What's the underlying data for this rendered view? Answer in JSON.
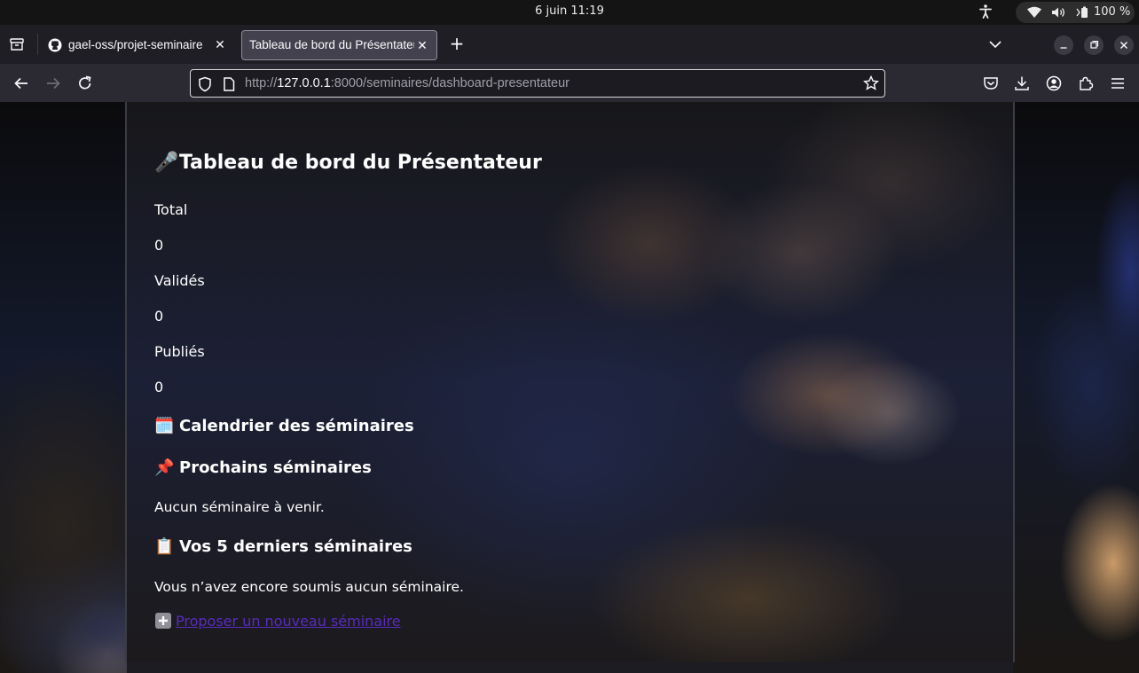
{
  "os": {
    "clock": "6 juin  11:19",
    "battery": "100 %"
  },
  "browser": {
    "tabs": [
      {
        "title": "gael-oss/projet-seminaire",
        "favicon": "github-icon",
        "active": false
      },
      {
        "title": "Tableau de bord du Présentateur",
        "favicon": "",
        "active": true
      }
    ],
    "url": {
      "scheme": "http://",
      "host": "127.0.0.1",
      "rest": ":8000/seminaires/dashboard-presentateur"
    }
  },
  "page": {
    "title_emoji": "🎤",
    "title": "Tableau de bord du Présentateur",
    "stats": [
      {
        "label": "Total",
        "value": "0"
      },
      {
        "label": "Validés",
        "value": "0"
      },
      {
        "label": "Publiés",
        "value": "0"
      }
    ],
    "calendar": {
      "emoji": "🗓️",
      "heading": "Calendrier des séminaires"
    },
    "upcoming": {
      "emoji": "📌",
      "heading": "Prochains séminaires",
      "empty_text": "Aucun séminaire à venir."
    },
    "recent": {
      "emoji": "📋",
      "heading": "Vos 5 derniers séminaires",
      "empty_text": "Vous n’avez encore soumis aucun séminaire."
    },
    "propose_link": "Proposer un nouveau séminaire"
  },
  "colors": {
    "link": "#5a2bbf",
    "tab_active_bg": "#42414d",
    "toolbar_bg": "#2b2a33"
  }
}
